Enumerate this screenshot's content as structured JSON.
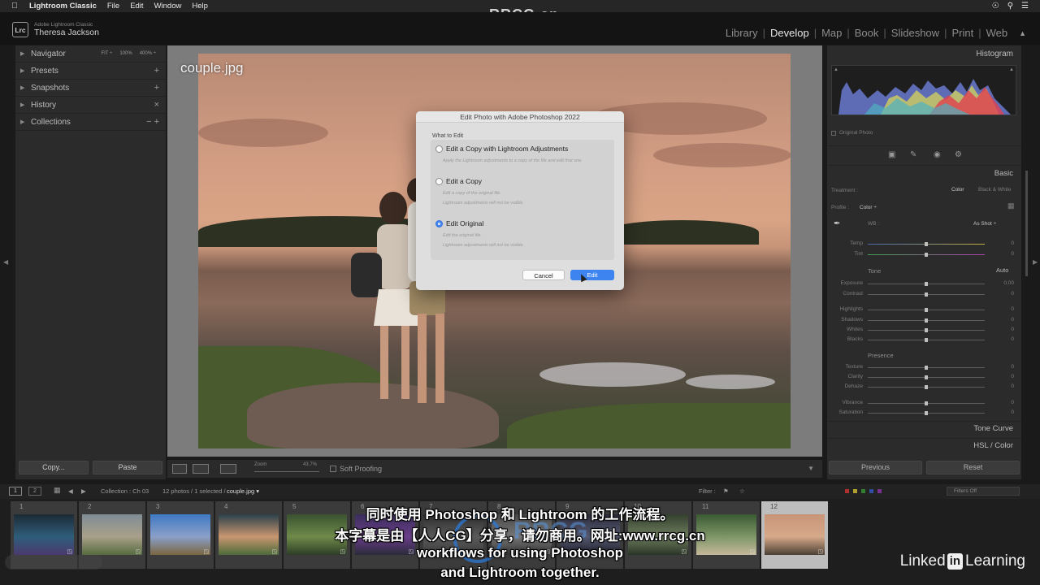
{
  "menubar": {
    "app_name": "Lightroom Classic",
    "menus": [
      "File",
      "Edit",
      "Window",
      "Help"
    ],
    "watermark": "RRCG.cn"
  },
  "identity": {
    "badge": "Lrc",
    "product": "Adobe Lightroom Classic",
    "user": "Theresa Jackson"
  },
  "modules": {
    "items": [
      "Library",
      "Develop",
      "Map",
      "Book",
      "Slideshow",
      "Print",
      "Web"
    ],
    "active": "Develop"
  },
  "left_panel": {
    "panels": [
      {
        "label": "Navigator",
        "right": ""
      },
      {
        "label": "Presets",
        "right": "+"
      },
      {
        "label": "Snapshots",
        "right": "+"
      },
      {
        "label": "History",
        "right": "×"
      },
      {
        "label": "Collections",
        "right": "−  +"
      }
    ],
    "navigator_opts": [
      "FIT ÷",
      "100%",
      "400% ÷"
    ],
    "copy_button": "Copy...",
    "paste_button": "Paste"
  },
  "photo": {
    "filename": "couple.jpg"
  },
  "dialog": {
    "title": "Edit Photo with Adobe Photoshop 2022",
    "section": "What to Edit",
    "options": [
      {
        "label": "Edit a Copy with Lightroom Adjustments",
        "desc1": "Apply the Lightroom adjustments to a copy of the file and edit that one.",
        "desc2": "",
        "selected": false
      },
      {
        "label": "Edit a Copy",
        "desc1": "Edit a copy of the original file.",
        "desc2": "Lightroom adjustments will not be visible.",
        "selected": false
      },
      {
        "label": "Edit Original",
        "desc1": "Edit the original file.",
        "desc2": "Lightroom adjustments will not be visible.",
        "selected": true
      }
    ],
    "cancel_label": "Cancel",
    "edit_label": "Edit"
  },
  "toolbar": {
    "zoom_label": "Zoom",
    "zoom_value": "43.7%",
    "soft_proofing": "Soft Proofing"
  },
  "right_panel": {
    "histogram_title": "Histogram",
    "original_photo": "Original Photo",
    "basic_title": "Basic",
    "treatment_label": "Treatment :",
    "treatment_color": "Color",
    "treatment_bw": "Black & White",
    "profile_label": "Profile :",
    "profile_value": "Color ÷",
    "wb_label": "WB :",
    "wb_value": "As Shot ÷",
    "tone_label": "Tone",
    "tone_auto": "Auto",
    "presence_label": "Presence",
    "sliders": [
      {
        "label": "Temp",
        "value": "0"
      },
      {
        "label": "Tint",
        "value": "0"
      },
      {
        "label": "Exposure",
        "value": "0.00"
      },
      {
        "label": "Contrast",
        "value": "0"
      },
      {
        "label": "Highlights",
        "value": "0"
      },
      {
        "label": "Shadows",
        "value": "0"
      },
      {
        "label": "Whites",
        "value": "0"
      },
      {
        "label": "Blacks",
        "value": "0"
      },
      {
        "label": "Texture",
        "value": "0"
      },
      {
        "label": "Clarity",
        "value": "0"
      },
      {
        "label": "Dehaze",
        "value": "0"
      },
      {
        "label": "Vibrance",
        "value": "0"
      },
      {
        "label": "Saturation",
        "value": "0"
      }
    ],
    "tone_curve": "Tone Curve",
    "hsl_color": "HSL / Color",
    "previous_button": "Previous",
    "reset_button": "Reset"
  },
  "filmstrip_bar": {
    "monitor1": "1",
    "monitor2": "2",
    "collection": "Collection : Ch 03",
    "count": "12 photos / 1 selected /",
    "selected_file": "couple.jpg ▾",
    "filter_label": "Filter :",
    "filters_off": "Filters Off"
  },
  "filmstrip": {
    "cells": [
      {
        "num": "1",
        "colors": [
          "#1c2a35",
          "#2f5d7a",
          "#4a3a6e"
        ]
      },
      {
        "num": "2",
        "colors": [
          "#7f8c95",
          "#a9a08a",
          "#556b3e"
        ]
      },
      {
        "num": "3",
        "colors": [
          "#3f78c4",
          "#8aa0c8",
          "#7a6540"
        ]
      },
      {
        "num": "4",
        "colors": [
          "#29404a",
          "#c99670",
          "#4c6a3a"
        ]
      },
      {
        "num": "5",
        "colors": [
          "#3a5230",
          "#6f8a4a",
          "#2d3d26"
        ]
      },
      {
        "num": "6",
        "colors": [
          "#3a2e5a",
          "#6a3e8a",
          "#2a2a3a"
        ]
      },
      {
        "num": "7",
        "colors": [
          "#2e2e2e",
          "#5a5a5a",
          "#3d3d3d"
        ]
      },
      {
        "num": "8",
        "colors": [
          "#4a4a4a",
          "#767676",
          "#333333"
        ]
      },
      {
        "num": "9",
        "colors": [
          "#2b2b3a",
          "#565a72",
          "#1f1f2a"
        ]
      },
      {
        "num": "10",
        "colors": [
          "#34402e",
          "#6e7d5e",
          "#2a3426"
        ]
      },
      {
        "num": "11",
        "colors": [
          "#3a5a32",
          "#7e9668",
          "#c5b89a"
        ]
      },
      {
        "num": "12",
        "colors": [
          "#c89478",
          "#d6a98a",
          "#4b4034"
        ]
      }
    ]
  },
  "subtitles": {
    "line1": "同时使用 Photoshop 和 Lightroom 的工作流程。",
    "line2": "本字幕是由【人人CG】分享，请勿商用。网址:www.rrcg.cn",
    "line3": "workflows for using Photoshop",
    "line4": "and Lightroom together."
  },
  "brand": {
    "linkedin_pre": "Linked",
    "linkedin_in": "in",
    "linkedin_post": "Learning",
    "watermark": "RRCG"
  }
}
